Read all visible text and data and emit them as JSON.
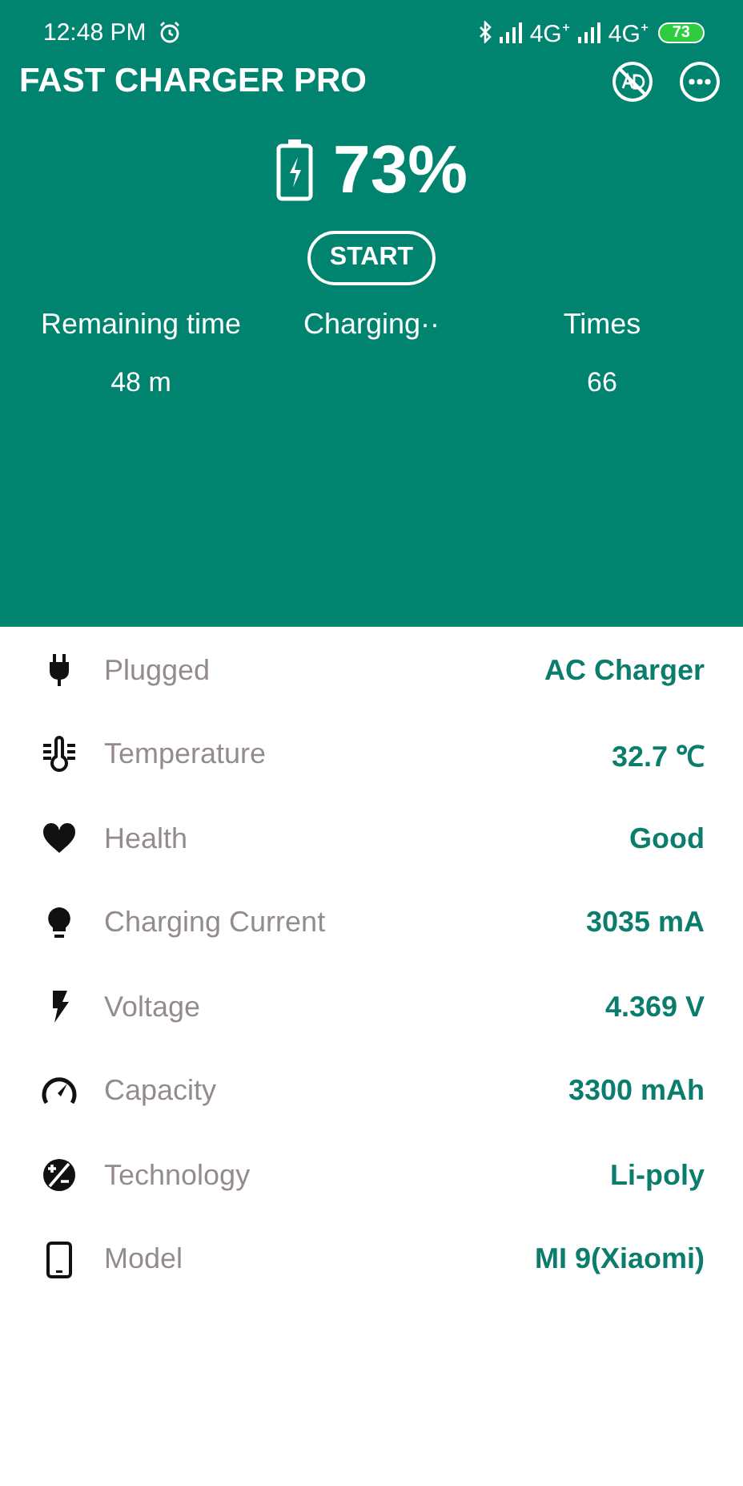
{
  "status_bar": {
    "time": "12:48 PM",
    "network_1": "4G⁺",
    "network_2": "4G⁺",
    "battery": "73"
  },
  "app_bar": {
    "title": "FAST CHARGER PRO"
  },
  "battery": {
    "percent": "73%",
    "button": "START"
  },
  "stats": [
    {
      "label": "Remaining time",
      "value": "48 m"
    },
    {
      "label": "Charging··"
    },
    {
      "label": "Times",
      "value": "66"
    }
  ],
  "details": [
    {
      "kind": "plug",
      "label": "Plugged",
      "value": "AC Charger"
    },
    {
      "kind": "thermometer",
      "label": "Temperature",
      "value": "32.7 ℃"
    },
    {
      "kind": "heart",
      "label": "Health",
      "value": "Good"
    },
    {
      "kind": "bulb",
      "label": "Charging Current",
      "value": "3035 mA"
    },
    {
      "kind": "bolt",
      "label": "Voltage",
      "value": "4.369 V"
    },
    {
      "kind": "gauge",
      "label": "Capacity",
      "value": "3300 mAh"
    },
    {
      "kind": "plusminus",
      "label": "Technology",
      "value": "Li-poly"
    },
    {
      "kind": "phone",
      "label": "Model",
      "value": "MI 9(Xiaomi)"
    }
  ]
}
